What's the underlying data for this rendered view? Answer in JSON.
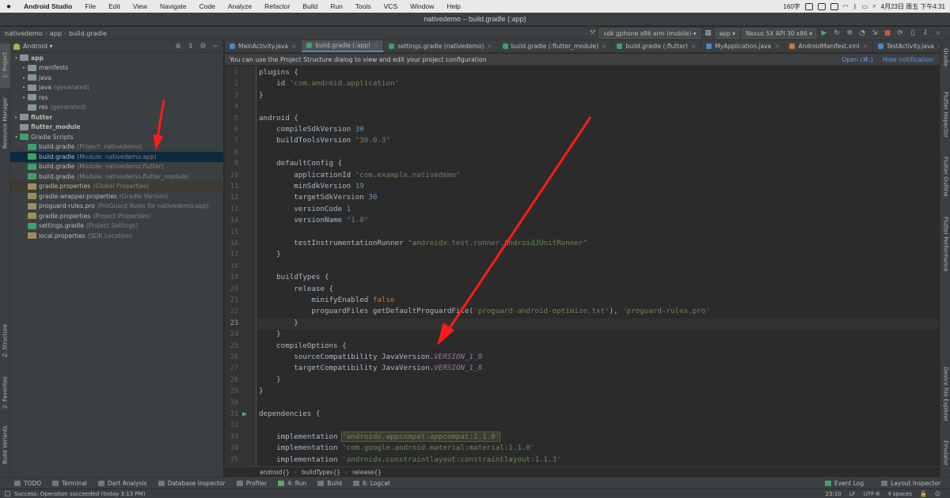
{
  "menubar": {
    "app_name": "Android Studio",
    "items": [
      "File",
      "Edit",
      "View",
      "Navigate",
      "Code",
      "Analyze",
      "Refactor",
      "Build",
      "Run",
      "Tools",
      "VCS",
      "Window",
      "Help"
    ],
    "status_text": "160字",
    "datetime": "4月23日 周五 下午4:31"
  },
  "window": {
    "title": "nativedemo – build.gradle (:app)"
  },
  "navbar": {
    "breadcrumbs": [
      "nativedemo",
      "app",
      "build.gradle"
    ],
    "device": "sdk gphone x86 arm (mobile)",
    "module": "app",
    "avd": "Nexus 5X API 30 x86"
  },
  "project": {
    "view": "Android",
    "tree": [
      {
        "label": "app",
        "note": "",
        "indent": 0,
        "arrow": "▾",
        "icon": "folder",
        "bold": true
      },
      {
        "label": "manifests",
        "note": "",
        "indent": 1,
        "arrow": "▸",
        "icon": "folder"
      },
      {
        "label": "java",
        "note": "",
        "indent": 1,
        "arrow": "▸",
        "icon": "folder"
      },
      {
        "label": "java",
        "note": "(generated)",
        "indent": 1,
        "arrow": "▸",
        "icon": "folder"
      },
      {
        "label": "res",
        "note": "",
        "indent": 1,
        "arrow": "▸",
        "icon": "folder"
      },
      {
        "label": "res",
        "note": "(generated)",
        "indent": 1,
        "arrow": "",
        "icon": "folder"
      },
      {
        "label": "flutter",
        "note": "",
        "indent": 0,
        "arrow": "▸",
        "icon": "folder",
        "bold": true
      },
      {
        "label": "flutter_module",
        "note": "",
        "indent": 0,
        "arrow": "",
        "icon": "folder",
        "bold": true
      },
      {
        "label": "Gradle Scripts",
        "note": "",
        "indent": 0,
        "arrow": "▾",
        "icon": "gradle"
      },
      {
        "label": "build.gradle",
        "note": "(Project: nativedemo)",
        "indent": 1,
        "arrow": "",
        "icon": "gradle"
      },
      {
        "label": "build.gradle",
        "note": "(Module: nativedemo.app)",
        "indent": 1,
        "arrow": "",
        "icon": "gradle",
        "selected": true
      },
      {
        "label": "build.gradle",
        "note": "(Module: nativedemo.flutter)",
        "indent": 1,
        "arrow": "",
        "icon": "gradle"
      },
      {
        "label": "build.gradle",
        "note": "(Module: nativedemo.flutter_module)",
        "indent": 1,
        "arrow": "",
        "icon": "gradle"
      },
      {
        "label": "gradle.properties",
        "note": "(Global Properties)",
        "indent": 1,
        "arrow": "",
        "icon": "prop",
        "highlight": true
      },
      {
        "label": "gradle-wrapper.properties",
        "note": "(Gradle Version)",
        "indent": 1,
        "arrow": "",
        "icon": "prop"
      },
      {
        "label": "proguard-rules.pro",
        "note": "(ProGuard Rules for nativedemo.app)",
        "indent": 1,
        "arrow": "",
        "icon": "prop"
      },
      {
        "label": "gradle.properties",
        "note": "(Project Properties)",
        "indent": 1,
        "arrow": "",
        "icon": "prop"
      },
      {
        "label": "settings.gradle",
        "note": "(Project Settings)",
        "indent": 1,
        "arrow": "",
        "icon": "gradle"
      },
      {
        "label": "local.properties",
        "note": "(SDK Location)",
        "indent": 1,
        "arrow": "",
        "icon": "prop"
      }
    ]
  },
  "left_strip": {
    "project": "1: Project",
    "resource": "Resource Manager",
    "structure": "Z: Structure",
    "favorites": "2: Favorites",
    "variants": "Build Variants"
  },
  "right_strip": {
    "gradle": "Gradle",
    "inspector": "Flutter Inspector",
    "outline": "Flutter Outline",
    "performance": "Flutter Performance",
    "device_explorer": "Device File Explorer",
    "emulator": "Emulator"
  },
  "tabs": [
    {
      "label": "MainActivity.java",
      "color": "#4a88c7"
    },
    {
      "label": "build.gradle (:app)",
      "color": "#3f9e6e",
      "active": true
    },
    {
      "label": "settings.gradle (nativedemo)",
      "color": "#3f9e6e"
    },
    {
      "label": "build.gradle (:flutter_module)",
      "color": "#3f9e6e"
    },
    {
      "label": "build.gradle (:flutter)",
      "color": "#3f9e6e"
    },
    {
      "label": "MyApplication.java",
      "color": "#4a88c7"
    },
    {
      "label": "AndroidManifest.xml",
      "color": "#c77a3f"
    },
    {
      "label": "TestActivity.java",
      "color": "#4a88c7"
    },
    {
      "label": "Flutte",
      "color": "#4a88c7"
    }
  ],
  "notification": {
    "text": "You can use the Project Structure dialog to view and edit your project configuration",
    "open": "Open (⌘;)",
    "hide": "Hide notification"
  },
  "editor": {
    "current_line": 23,
    "lines": [
      [
        [
          "",
          "plugins {"
        ]
      ],
      [
        [
          "",
          "    id "
        ],
        [
          "s",
          "'com.android.application'"
        ]
      ],
      [
        [
          "",
          "}"
        ]
      ],
      [
        [
          "",
          ""
        ]
      ],
      [
        [
          "",
          "android {"
        ]
      ],
      [
        [
          "",
          "    compileSdkVersion "
        ],
        [
          "n",
          "30"
        ]
      ],
      [
        [
          "",
          "    buildToolsVersion "
        ],
        [
          "s",
          "\"30.0.3\""
        ]
      ],
      [
        [
          "",
          ""
        ]
      ],
      [
        [
          "",
          "    defaultConfig {"
        ]
      ],
      [
        [
          "",
          "        applicationId "
        ],
        [
          "s",
          "\"com.example.nativedemo\""
        ]
      ],
      [
        [
          "",
          "        minSdkVersion "
        ],
        [
          "n",
          "19"
        ]
      ],
      [
        [
          "",
          "        targetSdkVersion "
        ],
        [
          "n",
          "30"
        ]
      ],
      [
        [
          "",
          "        versionCode "
        ],
        [
          "n",
          "1"
        ]
      ],
      [
        [
          "",
          "        versionName "
        ],
        [
          "s",
          "\"1.0\""
        ]
      ],
      [
        [
          "",
          ""
        ]
      ],
      [
        [
          "",
          "        testInstrumentationRunner "
        ],
        [
          "s",
          "\"androidx.test.runner.AndroidJUnitRunner\""
        ]
      ],
      [
        [
          "",
          "    }"
        ]
      ],
      [
        [
          "",
          ""
        ]
      ],
      [
        [
          "",
          "    buildTypes {"
        ]
      ],
      [
        [
          "",
          "        release {"
        ]
      ],
      [
        [
          "",
          "            minifyEnabled "
        ],
        [
          "k",
          "false"
        ]
      ],
      [
        [
          "",
          "            proguardFiles getDefaultProguardFile("
        ],
        [
          "s",
          "'proguard-android-optimize.txt'"
        ],
        [
          "",
          "), "
        ],
        [
          "s",
          "'proguard-rules.pro'"
        ]
      ],
      [
        [
          "",
          "        }"
        ]
      ],
      [
        [
          "",
          "    }"
        ]
      ],
      [
        [
          "",
          "    compileOptions {"
        ]
      ],
      [
        [
          "",
          "        sourceCompatibility JavaVersion."
        ],
        [
          "v",
          "VERSION_1_8"
        ]
      ],
      [
        [
          "",
          "        targetCompatibility JavaVersion."
        ],
        [
          "v",
          "VERSION_1_8"
        ]
      ],
      [
        [
          "",
          "    }"
        ]
      ],
      [
        [
          "",
          "}"
        ]
      ],
      [
        [
          "",
          ""
        ]
      ],
      [
        [
          "",
          "dependencies {"
        ]
      ],
      [
        [
          "",
          ""
        ]
      ],
      [
        [
          "",
          "    implementation "
        ],
        [
          "hs",
          "'androidx.appcompat:appcompat:1.1.0'"
        ]
      ],
      [
        [
          "",
          "    implementation "
        ],
        [
          "s",
          "'com.google.android.material:material:1.1.0'"
        ]
      ],
      [
        [
          "",
          "    implementation "
        ],
        [
          "s",
          "'androidx.constraintlayout:constraintlayout:1.1.3'"
        ]
      ]
    ]
  },
  "editor_breadcrumb": [
    "android{}",
    "buildTypes{}",
    "release{}"
  ],
  "tool_windows": [
    "TODO",
    "Terminal",
    "Dart Analysis",
    "Database Inspector",
    "Profiler",
    "4: Run",
    "Build",
    "6: Logcat"
  ],
  "tool_windows_right": [
    "Event Log",
    "Layout Inspector"
  ],
  "status": {
    "message": "Success: Operation succeeded (today 3:13 PM)",
    "position": "23:10",
    "line_sep": "LF",
    "encoding": "UTF-8",
    "indent": "4 spaces"
  }
}
